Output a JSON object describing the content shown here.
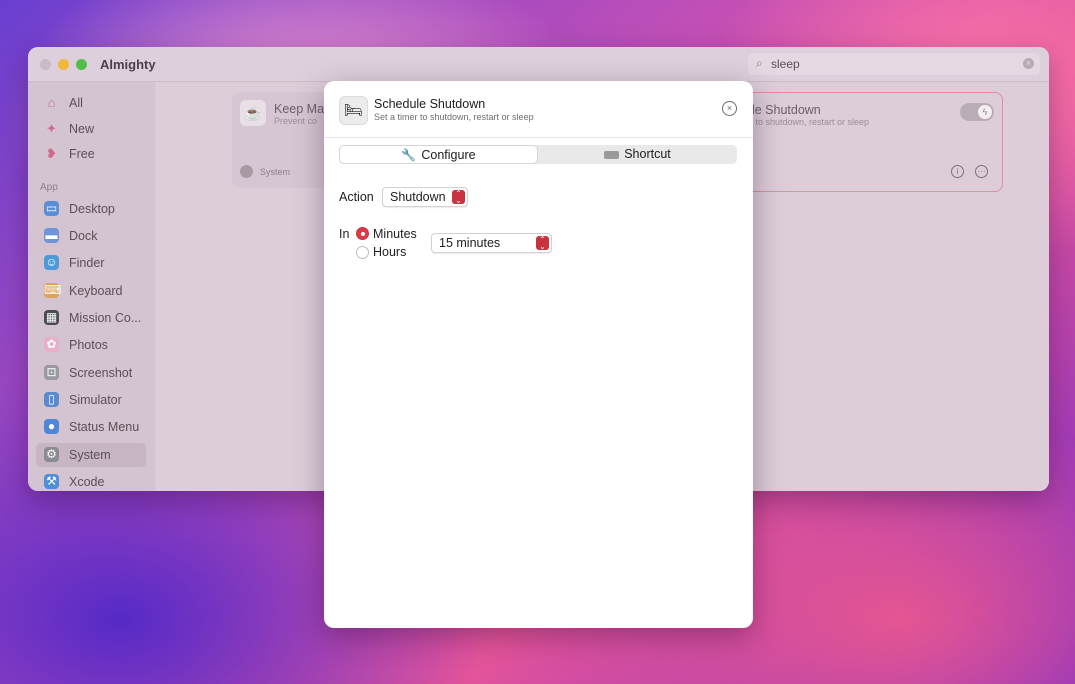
{
  "app": {
    "title": "Almighty"
  },
  "search": {
    "value": "sleep"
  },
  "sidebar": {
    "top_items": [
      {
        "label": "All",
        "icon": "home-icon"
      },
      {
        "label": "New",
        "icon": "sparkles-icon"
      },
      {
        "label": "Free",
        "icon": "lips-icon"
      }
    ],
    "section_label": "App",
    "apps": [
      {
        "label": "Desktop",
        "icon": "desktop-icon"
      },
      {
        "label": "Dock",
        "icon": "dock-icon"
      },
      {
        "label": "Finder",
        "icon": "finder-icon"
      },
      {
        "label": "Keyboard",
        "icon": "keyboard-icon"
      },
      {
        "label": "Mission Co...",
        "icon": "mission-control-icon"
      },
      {
        "label": "Photos",
        "icon": "photos-icon"
      },
      {
        "label": "Screenshot",
        "icon": "screenshot-icon"
      },
      {
        "label": "Simulator",
        "icon": "simulator-icon"
      },
      {
        "label": "Status Menu",
        "icon": "apple-icon"
      },
      {
        "label": "System",
        "icon": "system-gear-icon",
        "selected": true
      },
      {
        "label": "Xcode",
        "icon": "xcode-icon"
      }
    ]
  },
  "cards": {
    "left": {
      "title": "Keep Mac",
      "subtitle": "Prevent co",
      "footer": "System"
    },
    "right": {
      "title": "ule Shutdown",
      "subtitle": "er to shutdown, restart or sleep",
      "toggle_icon": "bolt-icon"
    }
  },
  "modal": {
    "title": "Schedule Shutdown",
    "subtitle": "Set a timer to shutdown, restart or sleep",
    "tabs": {
      "configure": "Configure",
      "shortcut": "Shortcut"
    },
    "action_label": "Action",
    "action_value": "Shutdown",
    "in_label": "In",
    "unit_options": {
      "minutes": "Minutes",
      "hours": "Hours",
      "selected": "Minutes"
    },
    "duration_value": "15 minutes"
  },
  "colors": {
    "accent": "#d93b47",
    "card_highlight": "#e08ea0"
  }
}
